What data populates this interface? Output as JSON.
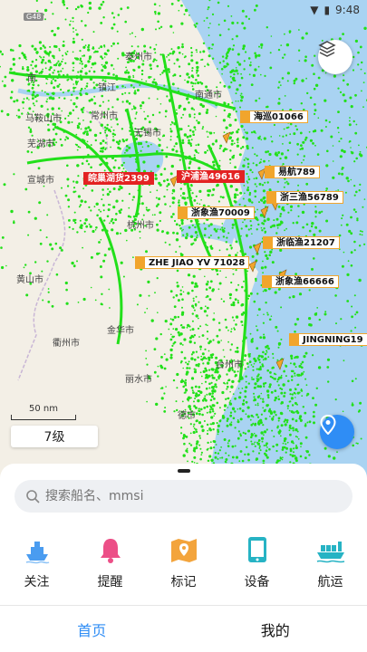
{
  "status_bar": {
    "time": "9:48"
  },
  "map": {
    "route_marker": "G48",
    "place_labels": [
      {
        "text": "泰州市"
      },
      {
        "text": "南"
      },
      {
        "text": "镇江"
      },
      {
        "text": "南通市"
      },
      {
        "text": "马鞍山市"
      },
      {
        "text": "常州市"
      },
      {
        "text": "芜湖市"
      },
      {
        "text": "无锡市"
      },
      {
        "text": "宣城市"
      },
      {
        "text": "杭州市"
      },
      {
        "text": "黄山市"
      },
      {
        "text": "衢州市"
      },
      {
        "text": "金华市"
      },
      {
        "text": "丽水市"
      },
      {
        "text": "台州市"
      },
      {
        "text": "德市"
      }
    ],
    "vessels": [
      {
        "name": "海巡01066",
        "color": "orange"
      },
      {
        "name": "皖巢湖货2399",
        "color": "red"
      },
      {
        "name": "沪浦渔49616",
        "color": "red"
      },
      {
        "name": "易航789",
        "color": "orange"
      },
      {
        "name": "浙三渔56789",
        "color": "orange"
      },
      {
        "name": "浙象渔70009",
        "color": "orange"
      },
      {
        "name": "浙临渔21207",
        "color": "orange"
      },
      {
        "name": "ZHE JIAO YV 71028",
        "color": "orange"
      },
      {
        "name": "浙象渔66666",
        "color": "orange"
      },
      {
        "name": "JINGNING19",
        "color": "orange"
      }
    ],
    "scale_label": "50 nm",
    "zoom_label": "7级"
  },
  "search": {
    "placeholder": "搜索船名、mmsi"
  },
  "tools": [
    {
      "label": "关注",
      "icon": "ship-follow-icon"
    },
    {
      "label": "提醒",
      "icon": "bell-icon"
    },
    {
      "label": "标记",
      "icon": "map-marker-icon"
    },
    {
      "label": "设备",
      "icon": "tablet-icon"
    },
    {
      "label": "航运",
      "icon": "cargo-ship-icon"
    }
  ],
  "tabs": [
    {
      "label": "首页",
      "active": true
    },
    {
      "label": "我的",
      "active": false
    }
  ],
  "colors": {
    "accent": "#2f8df5",
    "track": "#22e01a",
    "sea": "#a9d3f2",
    "vessel_orange": "#f1a52c",
    "vessel_red": "#e32222"
  }
}
